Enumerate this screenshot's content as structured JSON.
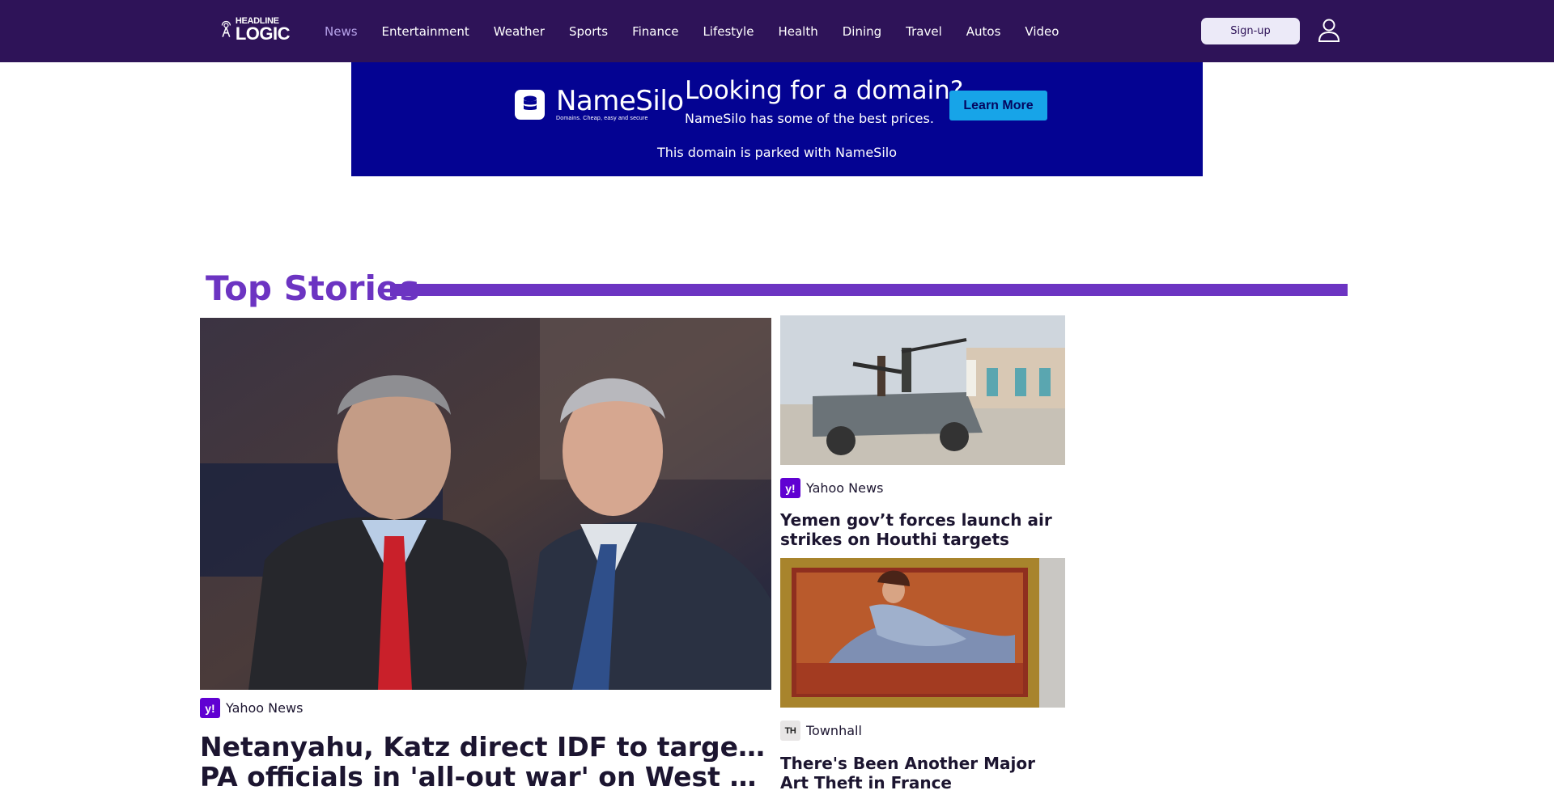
{
  "header": {
    "logo_line1": "HEADLINE",
    "logo_line2": "LOGIC",
    "nav": [
      "News",
      "Entertainment",
      "Weather",
      "Sports",
      "Finance",
      "Lifestyle",
      "Health",
      "Dining",
      "Travel",
      "Autos",
      "Video"
    ],
    "active_nav": "News",
    "signup_label": "Sign-up",
    "user_icon": "user-icon",
    "background": "#2e1358",
    "active_color": "#b7a3ea"
  },
  "ad": {
    "brand": "NameSilo",
    "tagline": "Domains. Cheap, easy and secure",
    "headline": "Looking for a domain?",
    "subtext": "NameSilo has some of the best prices.",
    "cta": "Learn More",
    "parked_text": "This domain is parked with NameSilo",
    "background": "#040392",
    "cta_color": "#17a4e8"
  },
  "section": {
    "title": "Top Stories",
    "accent": "#6c34c2"
  },
  "stories": {
    "hero": {
      "source": "Yahoo News",
      "source_icon": "y!",
      "title_line1": "Netanyahu, Katz direct IDF to target senior",
      "title_line2": "PA officials in 'all-out war' on West Bank..."
    },
    "side1": {
      "source": "Yahoo News",
      "source_icon": "y!",
      "title": "Yemen gov’t forces launch air strikes on Houthi targets"
    },
    "side2": {
      "source": "Townhall",
      "source_icon": "TH",
      "title": "There's Been Another Major Art Theft in France"
    }
  }
}
